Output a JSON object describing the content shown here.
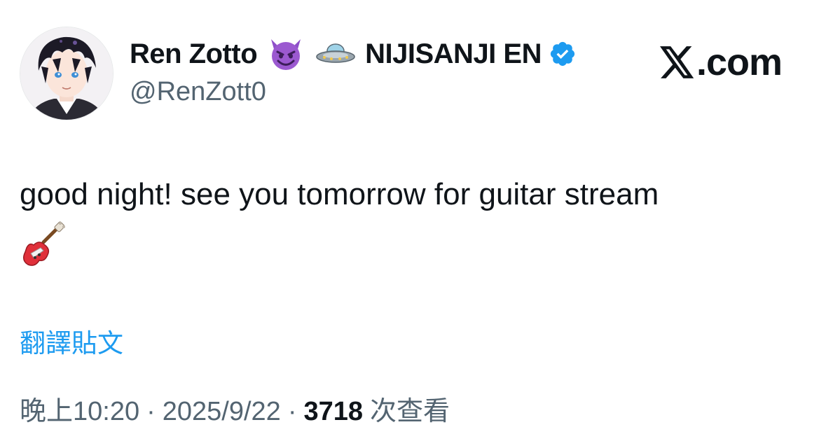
{
  "author": {
    "display_name": "Ren Zotto",
    "name_emojis": [
      "smiling-imp-icon",
      "ufo-icon"
    ],
    "group_name": "NIJISANJI EN",
    "verified_icon": "verified-badge-icon",
    "handle": "@RenZott0"
  },
  "brand": {
    "icon": "x-logo-icon",
    "text": ".com"
  },
  "tweet": {
    "text": "good night! see you tomorrow for guitar stream",
    "trailing_emoji": "guitar-icon"
  },
  "translate_label": "翻譯貼文",
  "meta": {
    "time": "晚上10:20",
    "separator": "·",
    "date": "2025/9/22",
    "views_count": "3718",
    "views_label": "次查看"
  },
  "colors": {
    "text_primary": "#0f1419",
    "text_secondary": "#536471",
    "link": "#1d9bf0",
    "verified": "#1d9bf0"
  }
}
